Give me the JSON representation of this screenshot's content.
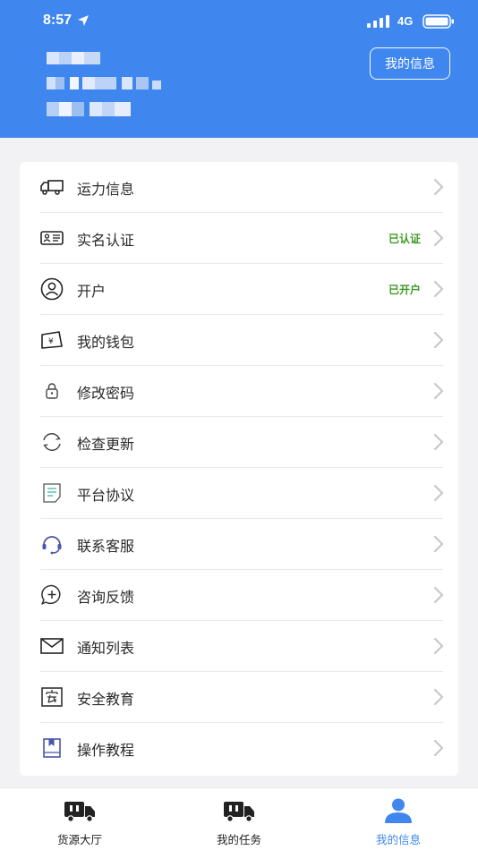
{
  "status_bar": {
    "time": "8:57",
    "network": "4G",
    "location_icon": "location-arrow-icon",
    "signal_icon": "signal-bars-icon",
    "battery_icon": "battery-icon"
  },
  "header": {
    "my_info_button": "我的信息",
    "bg_color": "#3f87ef"
  },
  "menu": {
    "items": [
      {
        "label": "运力信息",
        "icon": "truck-icon",
        "status": ""
      },
      {
        "label": "实名认证",
        "icon": "id-card-icon",
        "status": "已认证"
      },
      {
        "label": "开户",
        "icon": "user-circle-icon",
        "status": "已开户"
      },
      {
        "label": "我的钱包",
        "icon": "wallet-icon",
        "status": ""
      },
      {
        "label": "修改密码",
        "icon": "lock-icon",
        "status": ""
      },
      {
        "label": "检查更新",
        "icon": "refresh-icon",
        "status": ""
      },
      {
        "label": "平台协议",
        "icon": "document-icon",
        "status": ""
      },
      {
        "label": "联系客服",
        "icon": "headset-icon",
        "status": ""
      },
      {
        "label": "咨询反馈",
        "icon": "feedback-plus-icon",
        "status": ""
      },
      {
        "label": "通知列表",
        "icon": "mail-icon",
        "status": ""
      },
      {
        "label": "安全教育",
        "icon": "safety-icon",
        "status": ""
      },
      {
        "label": "操作教程",
        "icon": "book-icon",
        "status": ""
      }
    ],
    "status_color": "#3e9a25"
  },
  "tabbar": {
    "tabs": [
      {
        "label": "货源大厅",
        "icon": "cargo-truck-icon",
        "active": false
      },
      {
        "label": "我的任务",
        "icon": "task-truck-icon",
        "active": false
      },
      {
        "label": "我的信息",
        "icon": "person-icon",
        "active": true
      }
    ],
    "active_color": "#3f87ef"
  }
}
